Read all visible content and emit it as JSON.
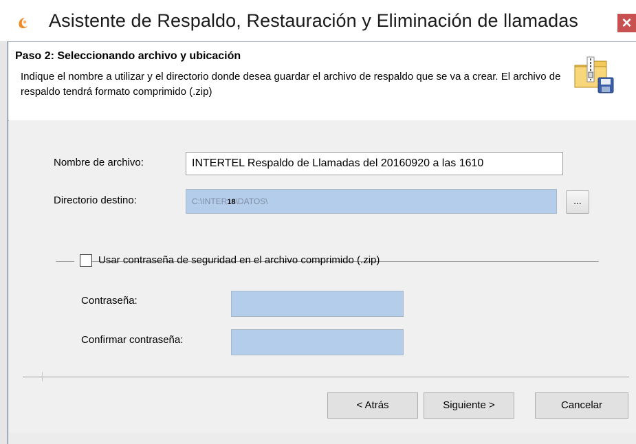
{
  "window": {
    "title": "Asistente de Respaldo, Restauración y Eliminación de llamadas",
    "close_label": "×",
    "app_icon": "orange-swirl-icon"
  },
  "header": {
    "step_title": "Paso 2: Seleccionando archivo y ubicación",
    "description": "Indique el nombre a utilizar y el directorio donde desea guardar el archivo de respaldo que se va a crear. El archivo de respaldo tendrá formato comprimido (.zip)",
    "icon": "zip-folder-save-icon"
  },
  "form": {
    "filename_label": "Nombre de archivo:",
    "filename_value": "INTERTEL Respaldo de Llamadas del 20160920 a las 1610",
    "directory_label": "Directorio destino:",
    "directory_value_prefix": "C:\\INTER",
    "directory_value_bold": "18",
    "directory_value_suffix": "\\DATOS\\",
    "browse_label": "...",
    "password_option": {
      "label": "Usar contraseña de seguridad en el archivo comprimido (.zip)",
      "checked": false
    },
    "password_label": "Contraseña:",
    "password_value": "",
    "confirm_label": "Confirmar contraseña:",
    "confirm_value": ""
  },
  "buttons": {
    "back": "< Atrás",
    "next": "Siguiente >",
    "cancel": "Cancelar"
  },
  "colors": {
    "close_button": "#c75050",
    "field_fill": "#b4cdeb"
  }
}
